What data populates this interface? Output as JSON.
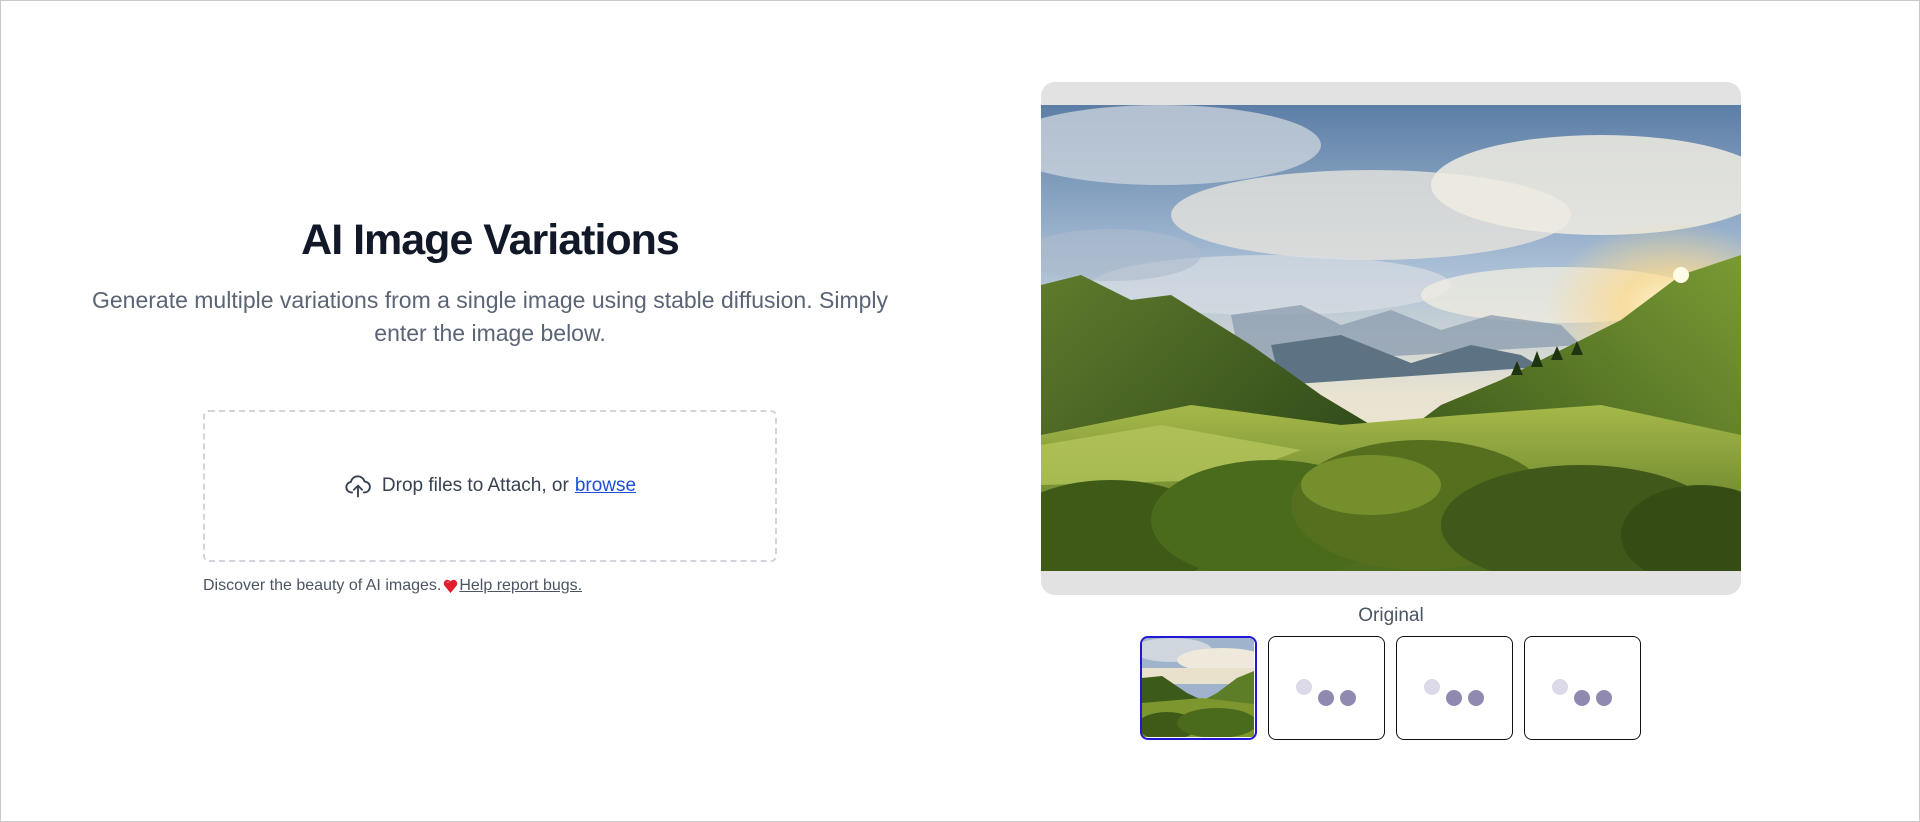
{
  "hero": {
    "title": "AI Image Variations",
    "subtitle": "Generate multiple variations from a single image using stable diffusion. Simply enter the image below."
  },
  "upload": {
    "text": "Drop files to Attach, or",
    "browse_label": "browse",
    "icon": "cloud-upload-icon"
  },
  "footer": {
    "note": "Discover the beauty of AI images.",
    "heart_icon": "heart-icon",
    "help_link": "Help report bugs."
  },
  "preview": {
    "caption": "Original",
    "image": "mountain-valley-sunset-photo"
  },
  "thumbnails": [
    {
      "state": "image",
      "selected": true
    },
    {
      "state": "loading",
      "selected": false
    },
    {
      "state": "loading",
      "selected": false
    },
    {
      "state": "loading",
      "selected": false
    }
  ],
  "colors": {
    "accent": "#2317d6",
    "link": "#1d4ed8",
    "heart": "#e11d2e",
    "loading_dot": "#8f8bb0"
  }
}
